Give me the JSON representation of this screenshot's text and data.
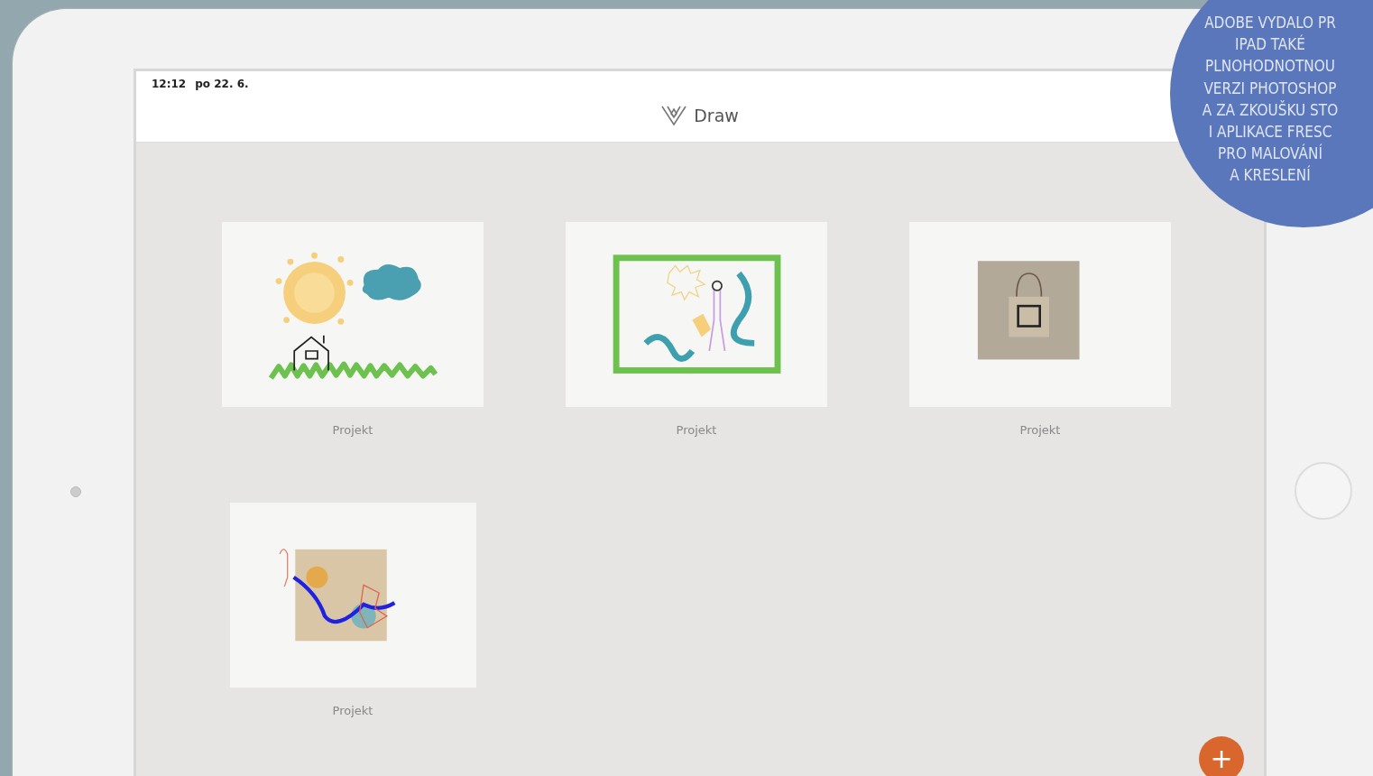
{
  "status_bar": {
    "time": "12:12",
    "date": "po 22. 6."
  },
  "app": {
    "title": "Draw"
  },
  "projects": [
    {
      "name": "Projekt",
      "kind": "sketch"
    },
    {
      "name": "Projekt",
      "kind": "frame"
    },
    {
      "name": "Projekt",
      "kind": "photo"
    },
    {
      "name": "Projekt",
      "kind": "collage"
    }
  ],
  "add_button": {
    "label": "+"
  },
  "caption_badge": {
    "lines": [
      "ADOBE VYDALO PR",
      "IPAD TAKÉ",
      "PLNOHODNOTNOU",
      "VERZI PHOTOSHOP",
      "A ZA ZKOUŠKU STO",
      "I APLIKACE FRESC",
      "PRO MALOVÁNÍ",
      "A KRESLENÍ"
    ]
  }
}
